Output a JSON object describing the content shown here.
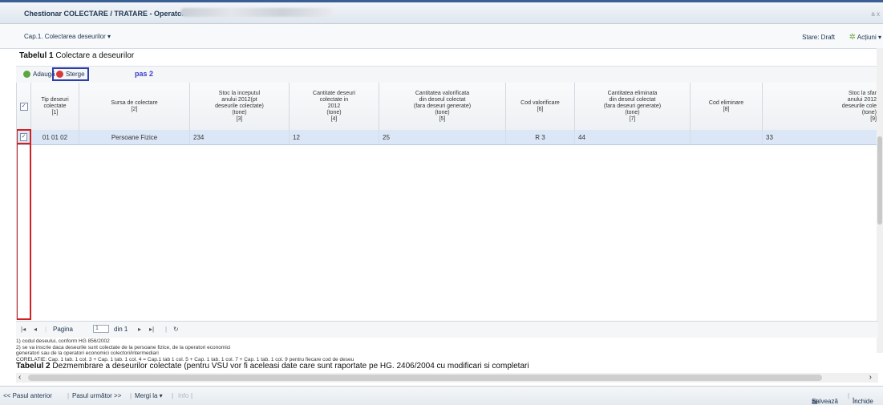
{
  "window": {
    "title": "Chestionar COLECTARE / TRATARE - Operator:",
    "controls": "a x"
  },
  "toolbar": {
    "chapter": "Cap.1. Colectarea deseurilor ▾",
    "stare": "Stare: Draft",
    "actiuni": "Acțiuni ▾"
  },
  "table1": {
    "title_bold": "Tabelul 1",
    "title_rest": " Colectare a deseurilor",
    "add_label": "Adaugă",
    "delete_label": "Sterge",
    "annotation": "pas 2"
  },
  "columns": [
    {
      "label": "Tip deseuri\ncolectate\n[1]"
    },
    {
      "label": "Sursa de colectare\n[2]"
    },
    {
      "label": "Stoc la inceputul\nanului 2012(pt\ndeseurile colectate)\n(tone)\n[3]"
    },
    {
      "label": "Cantitate deseuri\ncolectate in\n2012\n(tone)\n[4]"
    },
    {
      "label": "Cantitatea valorificata\ndin deseul colectat\n(fara deseuri generate)\n(tone)\n[5]"
    },
    {
      "label": "Cod valorificare\n[6]"
    },
    {
      "label": "Cantitatea eliminata\ndin deseul colectat\n(fara deseuri generate)\n(tone)\n[7]"
    },
    {
      "label": "Cod eliminare\n[8]"
    },
    {
      "label": "Stoc la sfar\nanului 2012\ndeseurile cole\n(tone)\n[9]"
    }
  ],
  "row": {
    "checked": "✓",
    "tip": "01 01 02",
    "sursa": "Persoane Fizice",
    "stoc_inceput": "234",
    "cantitate": "12",
    "valorificata": "25",
    "cod_valorificare": "R 3",
    "eliminata": "44",
    "cod_eliminare": "",
    "stoc_sfarsit": "33"
  },
  "pager": {
    "pagina_label": "Pagina",
    "page": "1",
    "din": "din 1"
  },
  "notes": [
    "1) codul deseului, conform HG 856/2002",
    "2) se va inscrie daca deseurile sunt colectate de la persoane fizice, de la operatori economici",
    "generatori sau de la operatori economici colectori/intermediari",
    "CORELATIE: Cap. 1 tab. 1 col. 3 + Cap. 1 tab. 1 col. 4 = Cap.1 tab 1 col. 5 + Cap. 1 tab. 1 col. 7 + Cap. 1 tab. 1 col. 9 pentru fiecare cod de deseu"
  ],
  "table2": {
    "title_bold": "Tabelul 2",
    "title_rest": " Dezmembrare a deseurilor colectate (pentru VSU vor fi aceleasi date care sunt raportate pe HG. 2406/2004 cu modificari si completari"
  },
  "bottom": {
    "prev": "<< Pasul anterior",
    "next": "Pasul următor >>",
    "goto": "Mergi la ▾",
    "info": "Info",
    "save": "Salvează",
    "close": "Închide"
  }
}
